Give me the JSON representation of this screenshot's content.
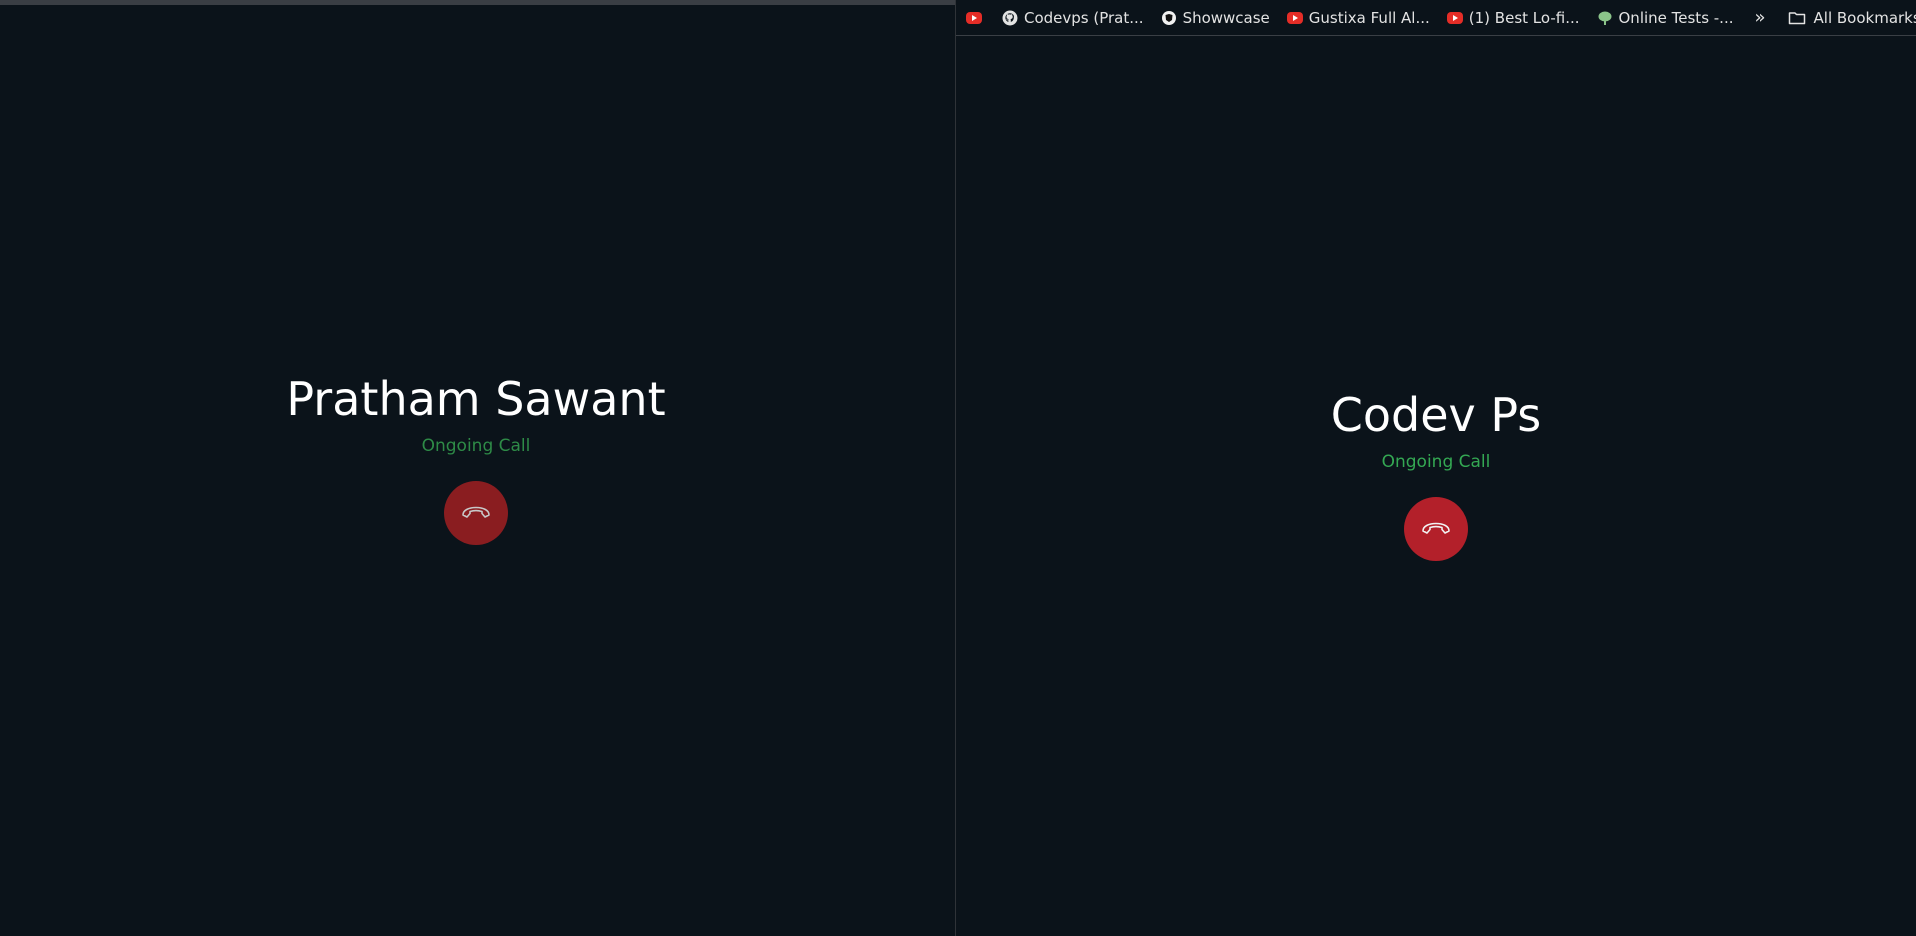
{
  "left_window": {
    "contact_name": "Pratham Sawant",
    "call_status": "Ongoing Call"
  },
  "right_window": {
    "bookmarks": [
      {
        "label": "",
        "icon": "youtube-icon"
      },
      {
        "label": "Codevps (Prat...",
        "icon": "github-icon"
      },
      {
        "label": "Showwcase",
        "icon": "showwcase-icon"
      },
      {
        "label": "Gustixa Full Al...",
        "icon": "youtube-icon"
      },
      {
        "label": "(1) Best Lo-fi...",
        "icon": "youtube-icon"
      },
      {
        "label": "Online Tests -...",
        "icon": "tree-icon"
      }
    ],
    "overflow_label": "»",
    "all_bookmarks_label": "All Bookmarks",
    "contact_name": "Codev Ps",
    "call_status": "Ongoing Call"
  },
  "colors": {
    "background": "#0b131a",
    "status_green": "#34a853",
    "hangup_red": "#b3202a"
  }
}
